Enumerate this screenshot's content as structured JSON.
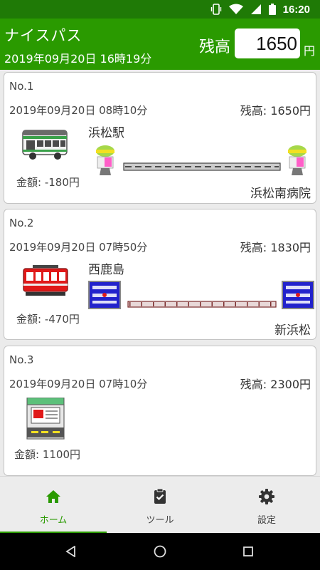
{
  "status_bar": {
    "time": "16:20",
    "icons": [
      "vibrate-icon",
      "wifi-icon",
      "signal-icon",
      "battery-icon"
    ]
  },
  "header": {
    "title": "ナイスパス",
    "datetime": "2019年09月20日 16時19分",
    "balance_label": "残高",
    "balance_value": "1650",
    "balance_unit": "円"
  },
  "history": [
    {
      "no": "No.1",
      "date": "2019年09月20日 08時10分",
      "remaining": "残高: 1650円",
      "amount": "金額: -180円",
      "from": "浜松駅",
      "to": "浜松南病院",
      "type": "bus-icon"
    },
    {
      "no": "No.2",
      "date": "2019年09月20日 07時50分",
      "remaining": "残高: 1830円",
      "amount": "金額: -470円",
      "from": "西鹿島",
      "to": "新浜松",
      "type": "train-icon"
    },
    {
      "no": "No.3",
      "date": "2019年09月20日 07時10分",
      "remaining": "残高: 2300円",
      "amount": "金額: 1100円",
      "type": "charge-machine-icon"
    }
  ],
  "bottom_nav": [
    {
      "label": "ホーム",
      "icon": "home-icon",
      "active": true
    },
    {
      "label": "ツール",
      "icon": "clipboard-icon",
      "active": false
    },
    {
      "label": "設定",
      "icon": "gear-icon",
      "active": false
    }
  ],
  "colors": {
    "primary": "#2a9a00",
    "status_bar": "#1f7a06",
    "station_sign": "#2222cc"
  }
}
